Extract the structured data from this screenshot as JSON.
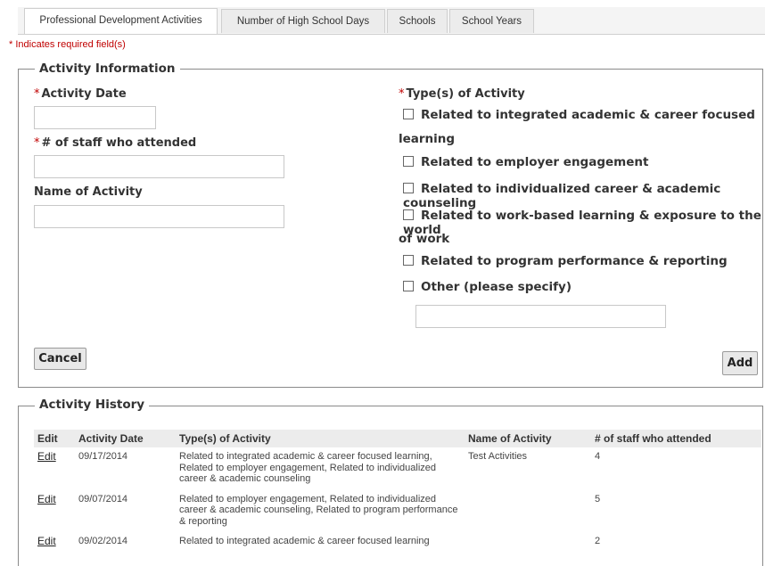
{
  "tabs": [
    {
      "label": "Professional Development Activities",
      "active": true
    },
    {
      "label": "Number of High School Days",
      "active": false
    },
    {
      "label": "Schools",
      "active": false
    },
    {
      "label": "School Years",
      "active": false
    }
  ],
  "required_note": "* Indicates required field(s)",
  "activity_info": {
    "legend": "Activity Information",
    "activity_date_label": "Activity Date",
    "staff_label": "# of staff who attended",
    "name_label": "Name of Activity",
    "activity_date_value": "",
    "staff_value": "",
    "name_value": "",
    "types_label": "Type(s) of Activity",
    "types": {
      "t1": "Related to integrated academic & career focused",
      "t1_wrap": "learning",
      "t2": "Related to employer engagement",
      "t3": "Related to individualized career & academic counseling",
      "t4": "Related to work-based learning & exposure to the world",
      "t4_wrap": "of work",
      "t5": "Related to program performance & reporting",
      "t6": "Other (please specify)"
    },
    "other_value": "",
    "cancel_label": "Cancel",
    "add_label": "Add"
  },
  "history": {
    "legend": "Activity History",
    "columns": {
      "edit": "Edit",
      "date": "Activity Date",
      "types": "Type(s) of Activity",
      "name": "Name of Activity",
      "staff": "# of staff who attended"
    },
    "rows": [
      {
        "edit": "Edit",
        "date": "09/17/2014",
        "types": "Related to integrated academic & career focused learning, Related to employer engagement, Related to individualized career & academic counseling",
        "name": "Test Activities",
        "staff": "4"
      },
      {
        "edit": "Edit",
        "date": "09/07/2014",
        "types": "Related to employer engagement, Related to individualized career & academic counseling, Related to program performance & reporting",
        "name": "",
        "staff": "5"
      },
      {
        "edit": "Edit",
        "date": "09/02/2014",
        "types": "Related to integrated academic & career focused learning",
        "name": "",
        "staff": "2"
      }
    ]
  }
}
